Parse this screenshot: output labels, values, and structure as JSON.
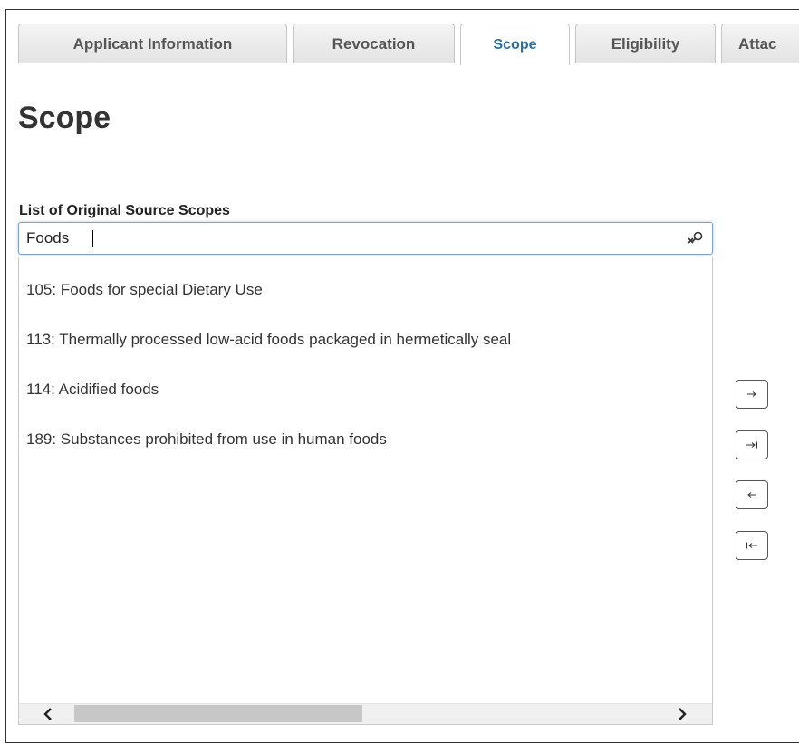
{
  "tabs": [
    {
      "label": "Applicant Information",
      "active": false
    },
    {
      "label": "Revocation",
      "active": false
    },
    {
      "label": "Scope",
      "active": true
    },
    {
      "label": "Eligibility",
      "active": false
    },
    {
      "label": "Attac",
      "active": false
    }
  ],
  "page": {
    "title": "Scope",
    "list_label": "List of Original Source Scopes"
  },
  "search": {
    "value": "Foods",
    "clear_icon": "clear-search-icon"
  },
  "results": [
    "105: Foods for special Dietary Use",
    "113: Thermally processed low-acid foods packaged in hermetically seal",
    "114: Acidified foods",
    "189: Substances prohibited from use in human foods"
  ],
  "move_buttons": [
    {
      "name": "move-right-icon",
      "glyph": "→"
    },
    {
      "name": "move-all-right-icon",
      "glyph": "→|"
    },
    {
      "name": "move-left-icon",
      "glyph": "←"
    },
    {
      "name": "move-all-left-icon",
      "glyph": "|←"
    }
  ],
  "colors": {
    "active_tab_text": "#2e6e9e",
    "focus_border": "#7fa4c8"
  }
}
